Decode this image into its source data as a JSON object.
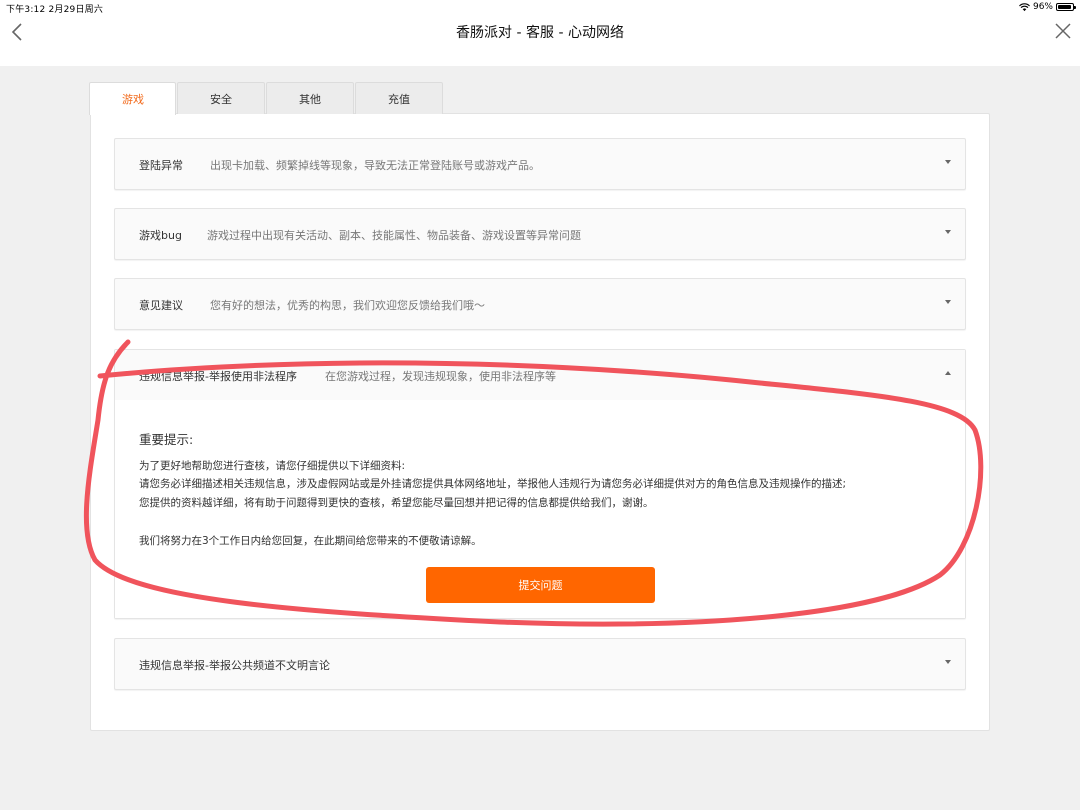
{
  "status_bar": {
    "time": "下午3:12   2月29日周六",
    "battery": "96%"
  },
  "nav": {
    "title": "香肠派对 - 客服 - 心动网络"
  },
  "tabs": [
    {
      "label": "游戏",
      "active": true
    },
    {
      "label": "安全",
      "active": false
    },
    {
      "label": "其他",
      "active": false
    },
    {
      "label": "充值",
      "active": false
    }
  ],
  "items": [
    {
      "name": "登陆异常",
      "desc": "出现卡加载、频繁掉线等现象，导致无法正常登陆账号或游戏产品。"
    },
    {
      "name": "游戏bug",
      "desc": "游戏过程中出现有关活动、副本、技能属性、物品装备、游戏设置等异常问题"
    },
    {
      "name": "意见建议",
      "desc": "您有好的想法，优秀的构思，我们欢迎您反馈给我们哦～"
    },
    {
      "name": "违规信息举报-举报使用非法程序",
      "desc": "在您游戏过程，发现违规现象，使用非法程序等"
    },
    {
      "name": "违规信息举报-举报公共频道不文明言论",
      "desc": ""
    }
  ],
  "expanded": {
    "notice_title": "重要提示:",
    "lines": [
      "为了更好地帮助您进行查核，请您仔细提供以下详细资料:",
      "请您务必详细描述相关违规信息，涉及虚假网站或是外挂请您提供具体网络地址，举报他人违规行为请您务必详细提供对方的角色信息及违规操作的描述;",
      "您提供的资料越详细，将有助于问题得到更快的查核，希望您能尽量回想并把记得的信息都提供给我们，谢谢。",
      "我们将努力在3个工作日内给您回复，在此期间给您带来的不便敬请谅解。"
    ],
    "submit_label": "提交问题"
  },
  "colors": {
    "accent": "#f26b1d",
    "button": "#ff6600",
    "annotation": "#f0545c"
  }
}
